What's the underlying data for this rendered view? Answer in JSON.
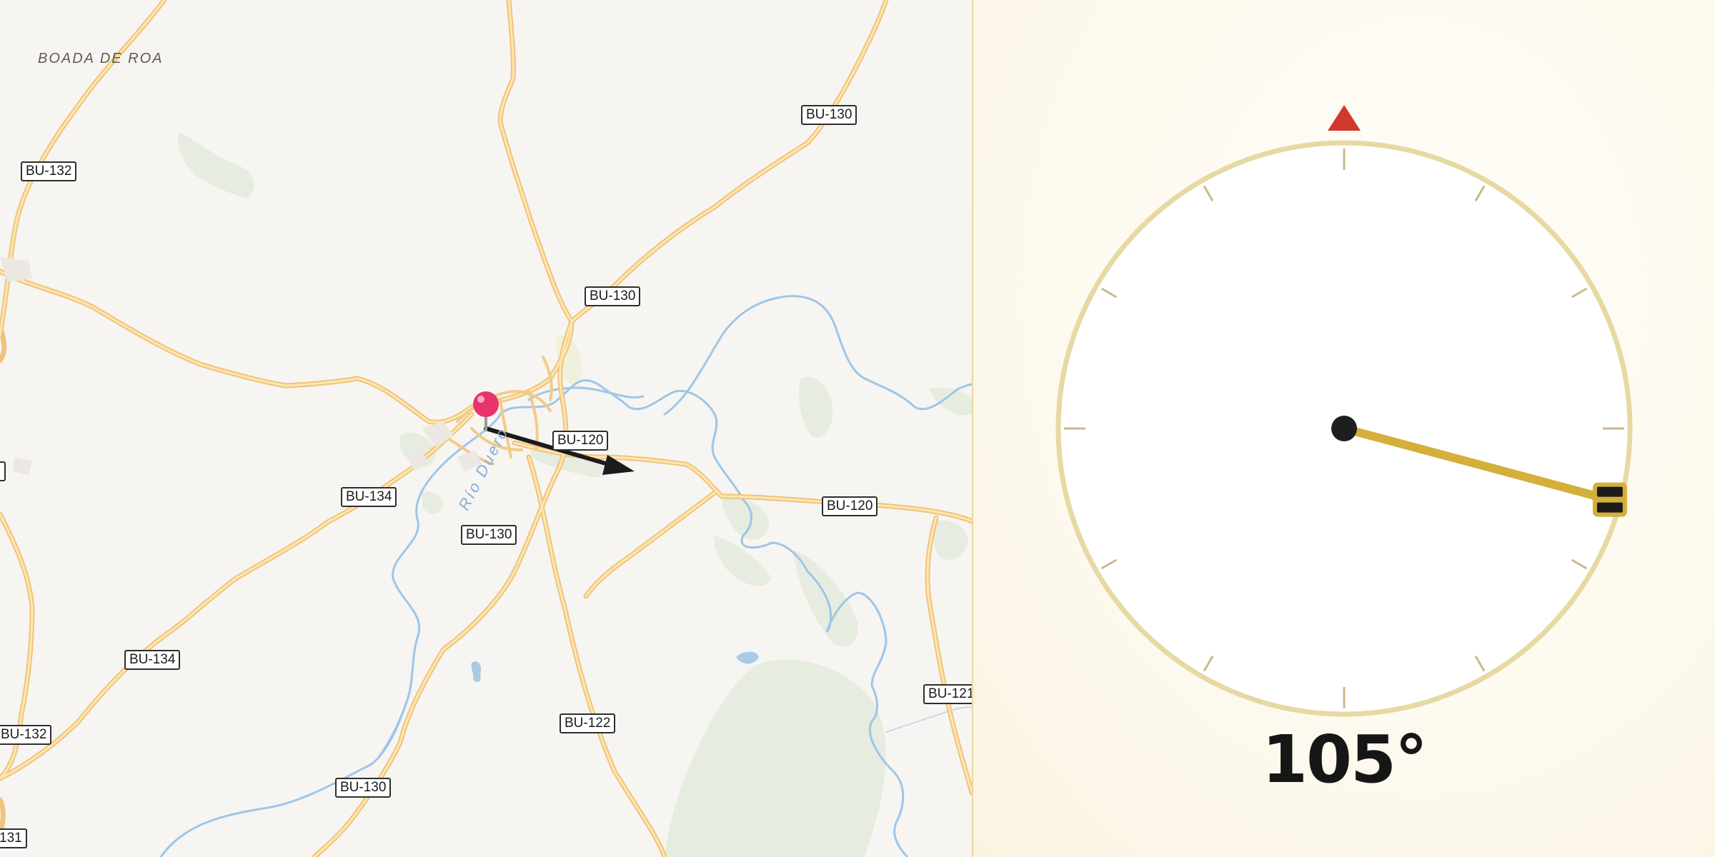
{
  "map": {
    "place_labels": [
      {
        "text": "BOADA DE ROA"
      }
    ],
    "river_label": "Río Duero",
    "road_shields": [
      {
        "text": "BU-130"
      },
      {
        "text": "BU-132"
      },
      {
        "text": "BU-130"
      },
      {
        "text": "BU-120"
      },
      {
        "text": "BU-134"
      },
      {
        "text": "BU-130"
      },
      {
        "text": "BU-120"
      },
      {
        "text": "BU-134"
      },
      {
        "text": "BU-121"
      },
      {
        "text": "BU-122"
      },
      {
        "text": "BU-132"
      },
      {
        "text": "BU-130"
      },
      {
        "text": "131"
      }
    ],
    "pin_color": "#e8336b"
  },
  "compass": {
    "heading_deg": 105,
    "heading_text": "105°",
    "north_marker_color": "#d0392b",
    "needle_color": "#d4b03a",
    "ring_color": "#e6d9a2"
  }
}
